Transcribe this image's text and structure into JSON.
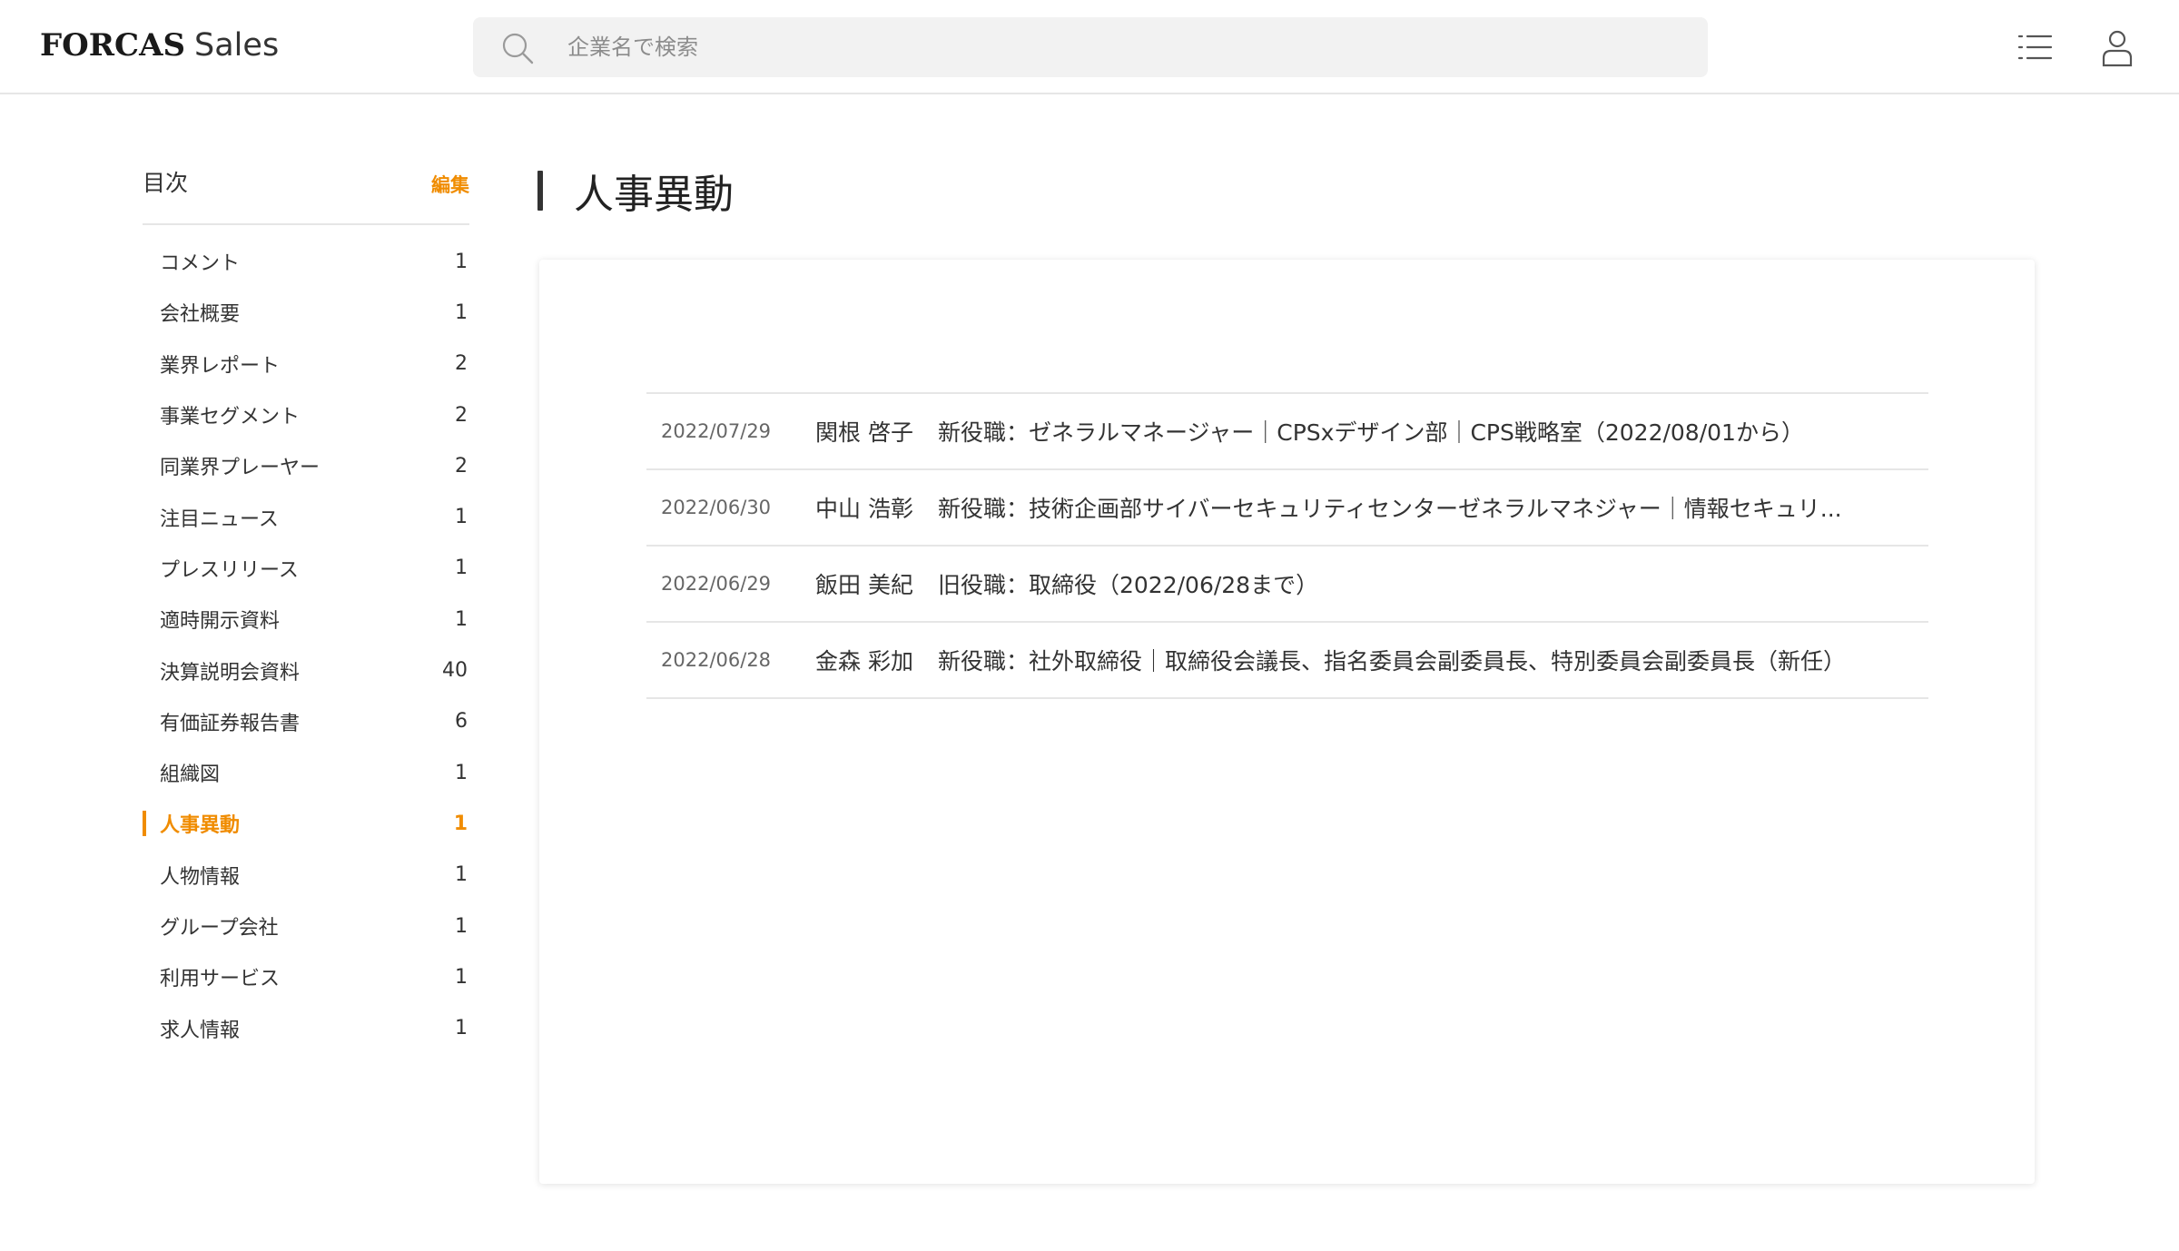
{
  "header": {
    "logo_brand": "FORCAS",
    "logo_sub": "Sales",
    "search_placeholder": "企業名で検索",
    "icons": [
      "search-icon",
      "list-icon",
      "user-icon"
    ]
  },
  "sidebar": {
    "title": "目次",
    "edit_label": "編集",
    "items": [
      {
        "label": "コメント",
        "count": "1"
      },
      {
        "label": "会社概要",
        "count": "1"
      },
      {
        "label": "業界レポート",
        "count": "2"
      },
      {
        "label": "事業セグメント",
        "count": "2"
      },
      {
        "label": "同業界プレーヤー",
        "count": "2"
      },
      {
        "label": "注目ニュース",
        "count": "1"
      },
      {
        "label": "プレスリリース",
        "count": "1"
      },
      {
        "label": "適時開示資料",
        "count": "1"
      },
      {
        "label": "決算説明会資料",
        "count": "40"
      },
      {
        "label": "有価証券報告書",
        "count": "6"
      },
      {
        "label": "組織図",
        "count": "1"
      },
      {
        "label": "人事異動",
        "count": "1",
        "active": true
      },
      {
        "label": "人物情報",
        "count": "1"
      },
      {
        "label": "グループ会社",
        "count": "1"
      },
      {
        "label": "利用サービス",
        "count": "1"
      },
      {
        "label": "求人情報",
        "count": "1"
      }
    ]
  },
  "main": {
    "title": "人事異動",
    "rows": [
      {
        "date": "2022/07/29",
        "person": "関根 啓子",
        "detail": "新役職：ゼネラルマネージャー｜CPSxデザイン部｜CPS戦略室（2022/08/01から）"
      },
      {
        "date": "2022/06/30",
        "person": "中山 浩彰",
        "detail": "新役職：技術企画部サイバーセキュリティセンターゼネラルマネジャー｜情報セキュリ..."
      },
      {
        "date": "2022/06/29",
        "person": "飯田 美紀",
        "detail": "旧役職：取締役（2022/06/28まで）"
      },
      {
        "date": "2022/06/28",
        "person": "金森 彩加",
        "detail": "新役職：社外取締役｜取締役会議長、指名委員会副委員長、特別委員会副委員長（新任）"
      }
    ]
  },
  "colors": {
    "accent": "#f08c00",
    "text": "#333333",
    "divider": "#e6e6e6",
    "search_bg": "#f2f2f2"
  }
}
